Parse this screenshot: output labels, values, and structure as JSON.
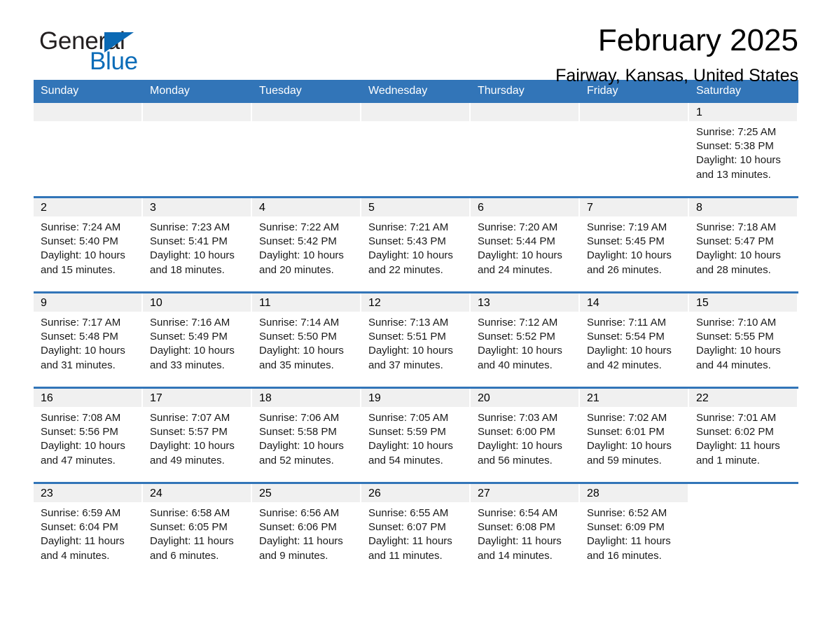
{
  "brand": {
    "name_part1": "General",
    "name_part2": "Blue",
    "triangle_color": "#0b69b4",
    "blue_color": "#0b6cb8"
  },
  "header": {
    "title": "February 2025",
    "subtitle": "Fairway, Kansas, United States",
    "header_bg": "#3275b8",
    "header_text_color": "#ffffff",
    "daynum_band_bg": "#f0f0f0"
  },
  "weekdays": [
    "Sunday",
    "Monday",
    "Tuesday",
    "Wednesday",
    "Thursday",
    "Friday",
    "Saturday"
  ],
  "weeks": [
    [
      {
        "day": "",
        "empty": true
      },
      {
        "day": "",
        "empty": true
      },
      {
        "day": "",
        "empty": true
      },
      {
        "day": "",
        "empty": true
      },
      {
        "day": "",
        "empty": true
      },
      {
        "day": "",
        "empty": true
      },
      {
        "day": "1",
        "sunrise": "Sunrise: 7:25 AM",
        "sunset": "Sunset: 5:38 PM",
        "daylight_line1": "Daylight: 10 hours",
        "daylight_line2": "and 13 minutes."
      }
    ],
    [
      {
        "day": "2",
        "sunrise": "Sunrise: 7:24 AM",
        "sunset": "Sunset: 5:40 PM",
        "daylight_line1": "Daylight: 10 hours",
        "daylight_line2": "and 15 minutes."
      },
      {
        "day": "3",
        "sunrise": "Sunrise: 7:23 AM",
        "sunset": "Sunset: 5:41 PM",
        "daylight_line1": "Daylight: 10 hours",
        "daylight_line2": "and 18 minutes."
      },
      {
        "day": "4",
        "sunrise": "Sunrise: 7:22 AM",
        "sunset": "Sunset: 5:42 PM",
        "daylight_line1": "Daylight: 10 hours",
        "daylight_line2": "and 20 minutes."
      },
      {
        "day": "5",
        "sunrise": "Sunrise: 7:21 AM",
        "sunset": "Sunset: 5:43 PM",
        "daylight_line1": "Daylight: 10 hours",
        "daylight_line2": "and 22 minutes."
      },
      {
        "day": "6",
        "sunrise": "Sunrise: 7:20 AM",
        "sunset": "Sunset: 5:44 PM",
        "daylight_line1": "Daylight: 10 hours",
        "daylight_line2": "and 24 minutes."
      },
      {
        "day": "7",
        "sunrise": "Sunrise: 7:19 AM",
        "sunset": "Sunset: 5:45 PM",
        "daylight_line1": "Daylight: 10 hours",
        "daylight_line2": "and 26 minutes."
      },
      {
        "day": "8",
        "sunrise": "Sunrise: 7:18 AM",
        "sunset": "Sunset: 5:47 PM",
        "daylight_line1": "Daylight: 10 hours",
        "daylight_line2": "and 28 minutes."
      }
    ],
    [
      {
        "day": "9",
        "sunrise": "Sunrise: 7:17 AM",
        "sunset": "Sunset: 5:48 PM",
        "daylight_line1": "Daylight: 10 hours",
        "daylight_line2": "and 31 minutes."
      },
      {
        "day": "10",
        "sunrise": "Sunrise: 7:16 AM",
        "sunset": "Sunset: 5:49 PM",
        "daylight_line1": "Daylight: 10 hours",
        "daylight_line2": "and 33 minutes."
      },
      {
        "day": "11",
        "sunrise": "Sunrise: 7:14 AM",
        "sunset": "Sunset: 5:50 PM",
        "daylight_line1": "Daylight: 10 hours",
        "daylight_line2": "and 35 minutes."
      },
      {
        "day": "12",
        "sunrise": "Sunrise: 7:13 AM",
        "sunset": "Sunset: 5:51 PM",
        "daylight_line1": "Daylight: 10 hours",
        "daylight_line2": "and 37 minutes."
      },
      {
        "day": "13",
        "sunrise": "Sunrise: 7:12 AM",
        "sunset": "Sunset: 5:52 PM",
        "daylight_line1": "Daylight: 10 hours",
        "daylight_line2": "and 40 minutes."
      },
      {
        "day": "14",
        "sunrise": "Sunrise: 7:11 AM",
        "sunset": "Sunset: 5:54 PM",
        "daylight_line1": "Daylight: 10 hours",
        "daylight_line2": "and 42 minutes."
      },
      {
        "day": "15",
        "sunrise": "Sunrise: 7:10 AM",
        "sunset": "Sunset: 5:55 PM",
        "daylight_line1": "Daylight: 10 hours",
        "daylight_line2": "and 44 minutes."
      }
    ],
    [
      {
        "day": "16",
        "sunrise": "Sunrise: 7:08 AM",
        "sunset": "Sunset: 5:56 PM",
        "daylight_line1": "Daylight: 10 hours",
        "daylight_line2": "and 47 minutes."
      },
      {
        "day": "17",
        "sunrise": "Sunrise: 7:07 AM",
        "sunset": "Sunset: 5:57 PM",
        "daylight_line1": "Daylight: 10 hours",
        "daylight_line2": "and 49 minutes."
      },
      {
        "day": "18",
        "sunrise": "Sunrise: 7:06 AM",
        "sunset": "Sunset: 5:58 PM",
        "daylight_line1": "Daylight: 10 hours",
        "daylight_line2": "and 52 minutes."
      },
      {
        "day": "19",
        "sunrise": "Sunrise: 7:05 AM",
        "sunset": "Sunset: 5:59 PM",
        "daylight_line1": "Daylight: 10 hours",
        "daylight_line2": "and 54 minutes."
      },
      {
        "day": "20",
        "sunrise": "Sunrise: 7:03 AM",
        "sunset": "Sunset: 6:00 PM",
        "daylight_line1": "Daylight: 10 hours",
        "daylight_line2": "and 56 minutes."
      },
      {
        "day": "21",
        "sunrise": "Sunrise: 7:02 AM",
        "sunset": "Sunset: 6:01 PM",
        "daylight_line1": "Daylight: 10 hours",
        "daylight_line2": "and 59 minutes."
      },
      {
        "day": "22",
        "sunrise": "Sunrise: 7:01 AM",
        "sunset": "Sunset: 6:02 PM",
        "daylight_line1": "Daylight: 11 hours",
        "daylight_line2": "and 1 minute."
      }
    ],
    [
      {
        "day": "23",
        "sunrise": "Sunrise: 6:59 AM",
        "sunset": "Sunset: 6:04 PM",
        "daylight_line1": "Daylight: 11 hours",
        "daylight_line2": "and 4 minutes."
      },
      {
        "day": "24",
        "sunrise": "Sunrise: 6:58 AM",
        "sunset": "Sunset: 6:05 PM",
        "daylight_line1": "Daylight: 11 hours",
        "daylight_line2": "and 6 minutes."
      },
      {
        "day": "25",
        "sunrise": "Sunrise: 6:56 AM",
        "sunset": "Sunset: 6:06 PM",
        "daylight_line1": "Daylight: 11 hours",
        "daylight_line2": "and 9 minutes."
      },
      {
        "day": "26",
        "sunrise": "Sunrise: 6:55 AM",
        "sunset": "Sunset: 6:07 PM",
        "daylight_line1": "Daylight: 11 hours",
        "daylight_line2": "and 11 minutes."
      },
      {
        "day": "27",
        "sunrise": "Sunrise: 6:54 AM",
        "sunset": "Sunset: 6:08 PM",
        "daylight_line1": "Daylight: 11 hours",
        "daylight_line2": "and 14 minutes."
      },
      {
        "day": "28",
        "sunrise": "Sunrise: 6:52 AM",
        "sunset": "Sunset: 6:09 PM",
        "daylight_line1": "Daylight: 11 hours",
        "daylight_line2": "and 16 minutes."
      },
      {
        "day": "",
        "empty": true,
        "trailing": true
      }
    ]
  ]
}
